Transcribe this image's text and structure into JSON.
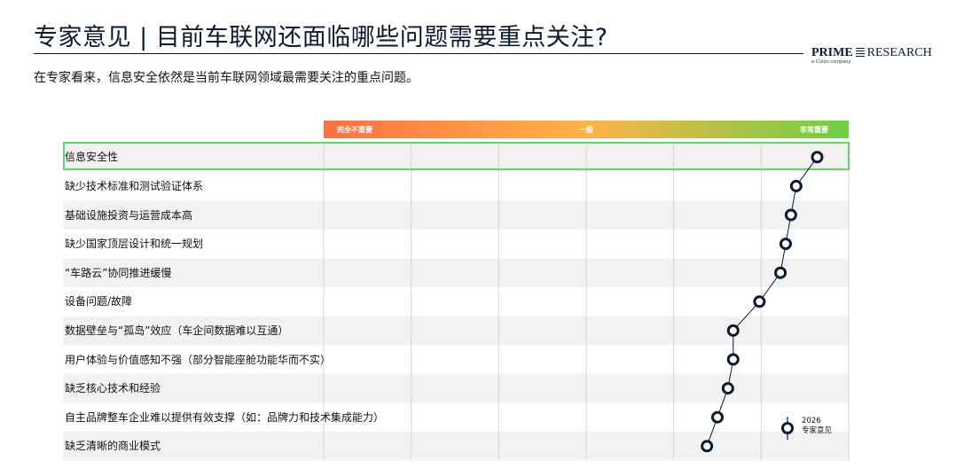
{
  "header": {
    "title": "专家意见 | 目前车联网还面临哪些问题需要重点关注?",
    "subtitle": "在专家看来，信息安全依然是当前车联网领域最需要关注的重点问题。",
    "logo": {
      "brand_bold": "PRIME",
      "brand_rest": "RESEARCH",
      "tagline": "a Cision company"
    }
  },
  "colors": {
    "navy": "#0b1a33",
    "highlight": "#6ad06a",
    "scale_low": "#ff7043",
    "scale_mid": "#ffb347",
    "scale_high": "#6ecf45",
    "row_band": "#f2f2f2"
  },
  "chart_data": {
    "type": "scatter",
    "scale_labels": {
      "low": "完全不重要",
      "mid": "一般",
      "high": "非常重要"
    },
    "legend": {
      "year": "2026",
      "name": "专家意见"
    },
    "grid": true,
    "highlighted_category": "信息安全性",
    "categories": [
      "信息安全性",
      "缺少技术标准和测试验证体系",
      "基础设施投资与运营成本高",
      "缺少国家顶层设计和统一规划",
      "“车路云”协同推进缓慢",
      "设备问题/故障",
      "数据壁垒与“孤岛”效应（车企间数据难以互通）",
      "用户体验与价值感知不强（部分智能座舱功能华而不实）",
      "缺乏核心技术和经验",
      "自主品牌整车企业难以提供有效支撑（如：品牌力和技术集成能力）",
      "缺乏清晰的商业模式"
    ],
    "values": [
      0.94,
      0.9,
      0.89,
      0.88,
      0.87,
      0.83,
      0.78,
      0.78,
      0.77,
      0.75,
      0.73
    ]
  }
}
